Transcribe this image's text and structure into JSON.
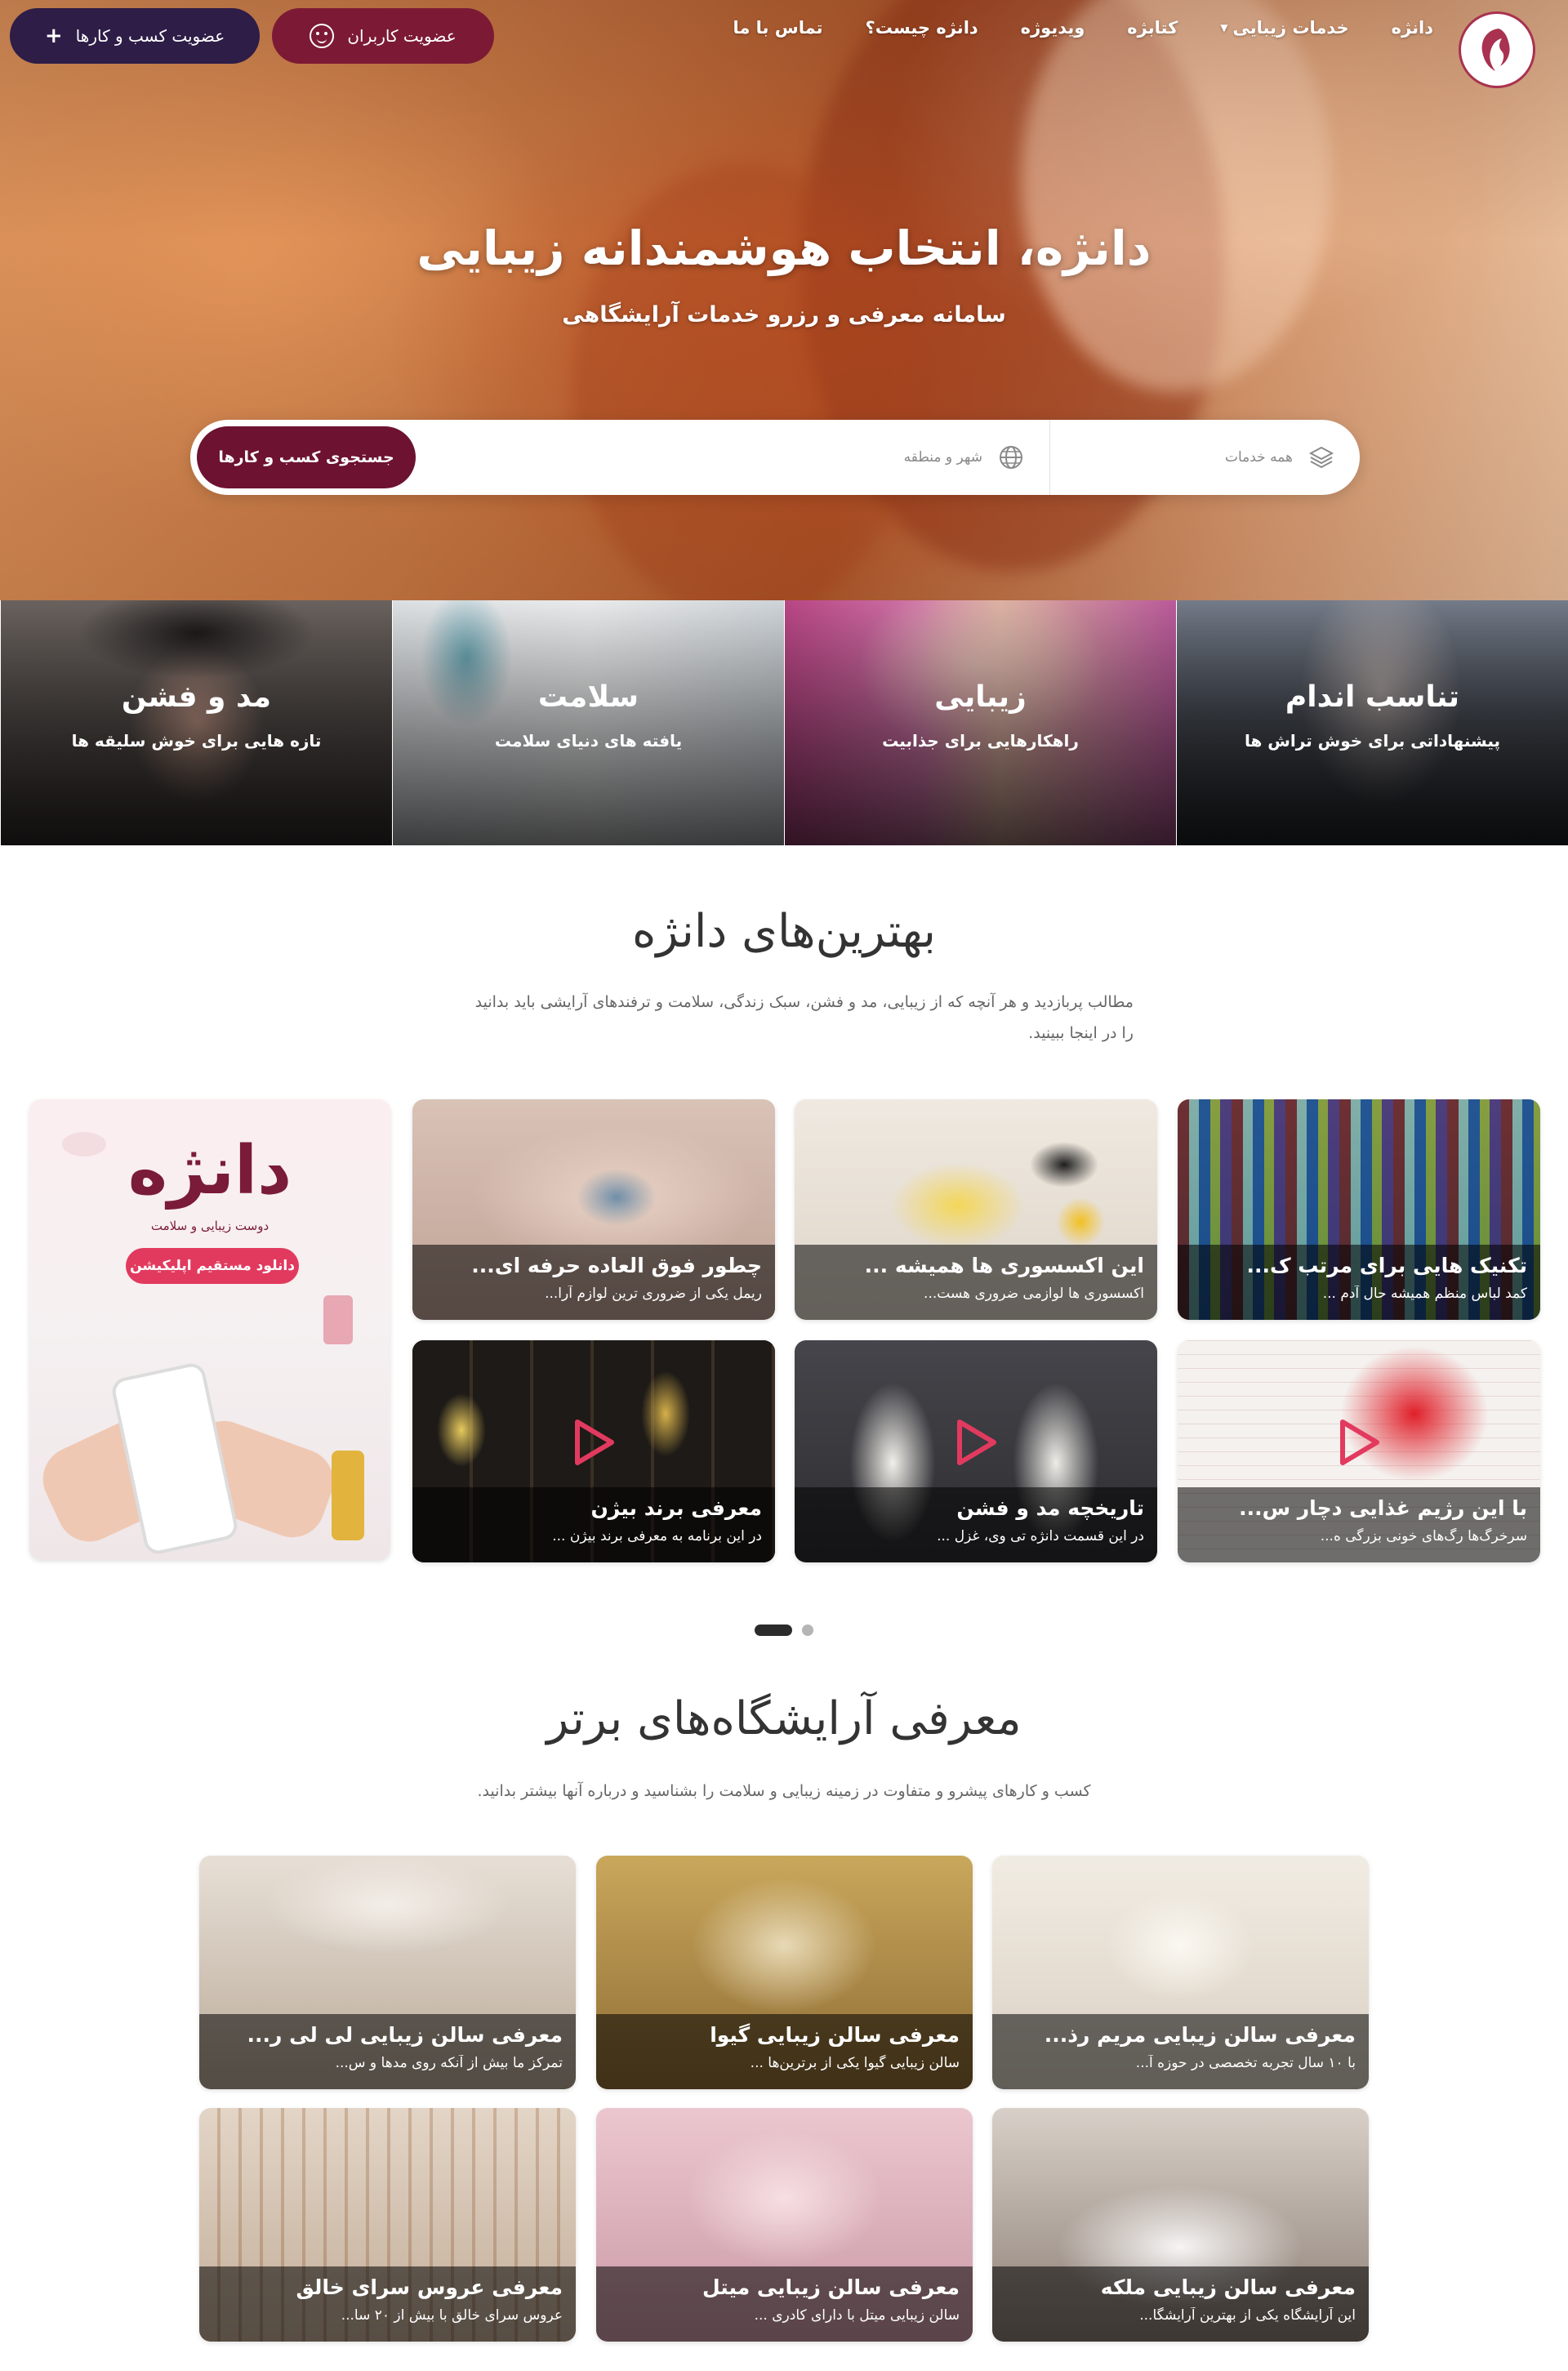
{
  "colors": {
    "primary": "#6d1230",
    "accent": "#7c1a35",
    "dark_button": "#2d1d47",
    "promo_pink": "#e23a5f"
  },
  "nav": {
    "logo_icon": "woman-silhouette-logo",
    "items": [
      {
        "label": "دانژه",
        "has_dropdown": false
      },
      {
        "label": "خدمات زیبایی",
        "has_dropdown": true
      },
      {
        "label": "کتابژه",
        "has_dropdown": false
      },
      {
        "label": "ویدیوژه",
        "has_dropdown": false
      },
      {
        "label": "دانژه چیست؟",
        "has_dropdown": false
      },
      {
        "label": "تماس با ما",
        "has_dropdown": false
      }
    ],
    "users_button": "عضویت کاربران",
    "business_button": "عضویت کسب و کارها"
  },
  "hero": {
    "title": "دانژه، انتخاب هوشمندانه زیبایی",
    "subtitle": "سامانه معرفی و رزرو خدمات آرایشگاهی"
  },
  "search": {
    "services_label": "همه خدمات",
    "services_icon": "layers-icon",
    "city_label": "شهر و منطقه",
    "city_icon": "globe-icon",
    "button": "جستجوی کسب و کارها"
  },
  "categories": [
    {
      "title": "تناسب اندام",
      "subtitle": "پیشنهاداتی برای خوش تراش ها"
    },
    {
      "title": "زیبایی",
      "subtitle": "راهکارهایی برای جذابیت"
    },
    {
      "title": "سلامت",
      "subtitle": "یافته های دنیای سلامت"
    },
    {
      "title": "مد و فشن",
      "subtitle": "تازه هایی برای خوش سلیقه ها"
    }
  ],
  "best": {
    "title": "بهترین‌های دانژه",
    "description_line1": "مطالب پربازدید و هر آنچه که از زیبایی، مد و فشن، سبک زندگی، سلامت و ترفندهای آرایشی باید بدانید",
    "description_line2": "را در اینجا ببینید.",
    "cards": [
      {
        "title": "تکنیک هایی برای مرتب ک...",
        "subtitle": "کمد لباس منظم همیشه حال آدم ...",
        "video": false
      },
      {
        "title": "این اکسسوری ها همیشه ...",
        "subtitle": "اکسسوری ها لوازمی ضروری هست...",
        "video": false
      },
      {
        "title": "چطور فوق العاده حرفه ای...",
        "subtitle": "ریمل یکی از ضروری ترین لوازم آرا...",
        "video": false
      },
      {
        "title": "با این رژیم غذایی دچار س...",
        "subtitle": "سرخرگ‌ها رگ‌های خونی بزرگی ه...",
        "video": true
      },
      {
        "title": "تاریخچه مد و فشن",
        "subtitle": "در این قسمت دانژه تی وی، غزل ...",
        "video": true
      },
      {
        "title": "معرفی برند بیژن",
        "subtitle": "در این برنامه به معرفی برند بیژن ...",
        "video": true
      }
    ],
    "promo": {
      "logo": "دانژه",
      "tagline": "دوست زیبایی و سلامت",
      "button": "دانلود مستقیم اپلیکیشن"
    }
  },
  "salons": {
    "title": "معرفی آرایشگاه‌های برتر",
    "description": "کسب و کارهای پیشرو و متفاوت در زمینه زیبایی و سلامت را بشناسید و درباره آنها بیشتر بدانید.",
    "cards": [
      {
        "title": "معرفی سالن زیبایی مریم رذ...",
        "subtitle": "با ۱۰ سال تجربه تخصصی در حوزه آ..."
      },
      {
        "title": "معرفی سالن زیبایی گیوا",
        "subtitle": "سالن زیبایی گیوا یکی از برترین‌ها ..."
      },
      {
        "title": "معرفی سالن زیبایی لی لی ر...",
        "subtitle": "تمرکز ما بیش از آنکه روی مدها و س..."
      },
      {
        "title": "معرفی سالن زیبایی ملکه",
        "subtitle": "این آرایشگاه یکی از بهترین آرایشگا..."
      },
      {
        "title": "معرفی سالن زیبایی میتل",
        "subtitle": "سالن زیبایی میتل با دارای کادری ..."
      },
      {
        "title": "معرفی عروس سرای خالق",
        "subtitle": "عروس سرای خالق با بیش از ۲۰ سا..."
      }
    ]
  }
}
